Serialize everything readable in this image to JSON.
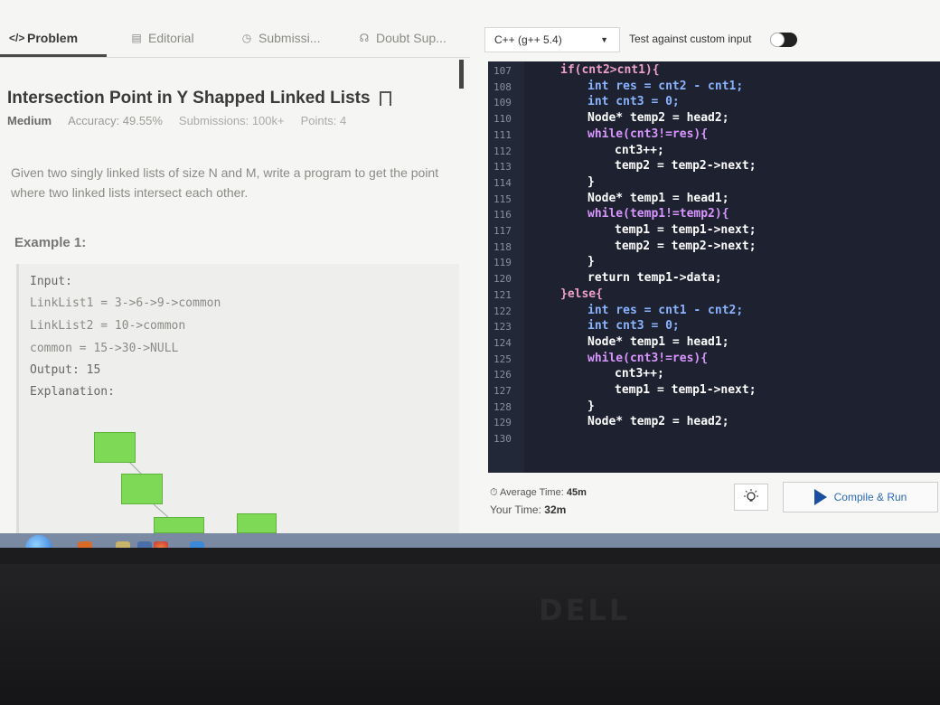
{
  "tabs": [
    {
      "label": "Problem",
      "icon": "code-icon"
    },
    {
      "label": "Editorial",
      "icon": "document-icon"
    },
    {
      "label": "Submissi...",
      "icon": "clock-icon"
    },
    {
      "label": "Doubt Sup...",
      "icon": "headset-icon"
    }
  ],
  "problem": {
    "title": "Intersection Point in Y Shapped Linked Lists",
    "difficulty": "Medium",
    "accuracy": "Accuracy: 49.55%",
    "submissions": "Submissions: 100k+",
    "points": "Points: 4",
    "description": "Given two singly linked lists of size N and M, write a program to get the point where two linked lists intersect each other.",
    "example_heading": "Example 1:",
    "example_lines": [
      "Input:",
      "LinkList1 = 3->6->9->common",
      "LinkList2 = 10->common",
      "common = 15->30->NULL",
      "Output: 15",
      "Explanation:"
    ]
  },
  "toolbar": {
    "language": "C++ (g++ 5.4)",
    "custom_input_label": "Test against custom input",
    "custom_input_enabled": false
  },
  "editor": {
    "line_numbers": [
      "107",
      "108",
      "109",
      "110",
      "111",
      "112",
      "113",
      "114",
      "115",
      "116",
      "117",
      "118",
      "119",
      "120",
      "121",
      "122",
      "123",
      "124",
      "125",
      "126",
      "127",
      "128",
      "129",
      "130"
    ],
    "lines": [
      "if(cnt2>cnt1){",
      "int res = cnt2 - cnt1;",
      "int cnt3 = 0;",
      "Node* temp2 = head2;",
      "while(cnt3!=res){",
      "cnt3++;",
      "temp2 = temp2->next;",
      "}",
      "Node* temp1 = head1;",
      "while(temp1!=temp2){",
      "temp1 = temp1->next;",
      "temp2 = temp2->next;",
      "}",
      "return temp1->data;",
      "}else{",
      "int res = cnt1 - cnt2;",
      "int cnt3 = 0;",
      "Node* temp1 = head1;",
      "while(cnt3!=res){",
      "cnt3++;",
      "temp1 = temp1->next;",
      "}",
      "Node* temp2 = head2;",
      ""
    ]
  },
  "footer": {
    "average_time_label": "Average Time:",
    "average_time_value": "45m",
    "your_time_label": "Your Time:",
    "your_time_value": "32m",
    "run_label": "Compile & Run"
  },
  "bezel": {
    "brand": "DELL"
  },
  "colors": {
    "node_green": "#7ed957",
    "editor_bg": "#1e2230",
    "run_text": "#2a6ab8"
  }
}
